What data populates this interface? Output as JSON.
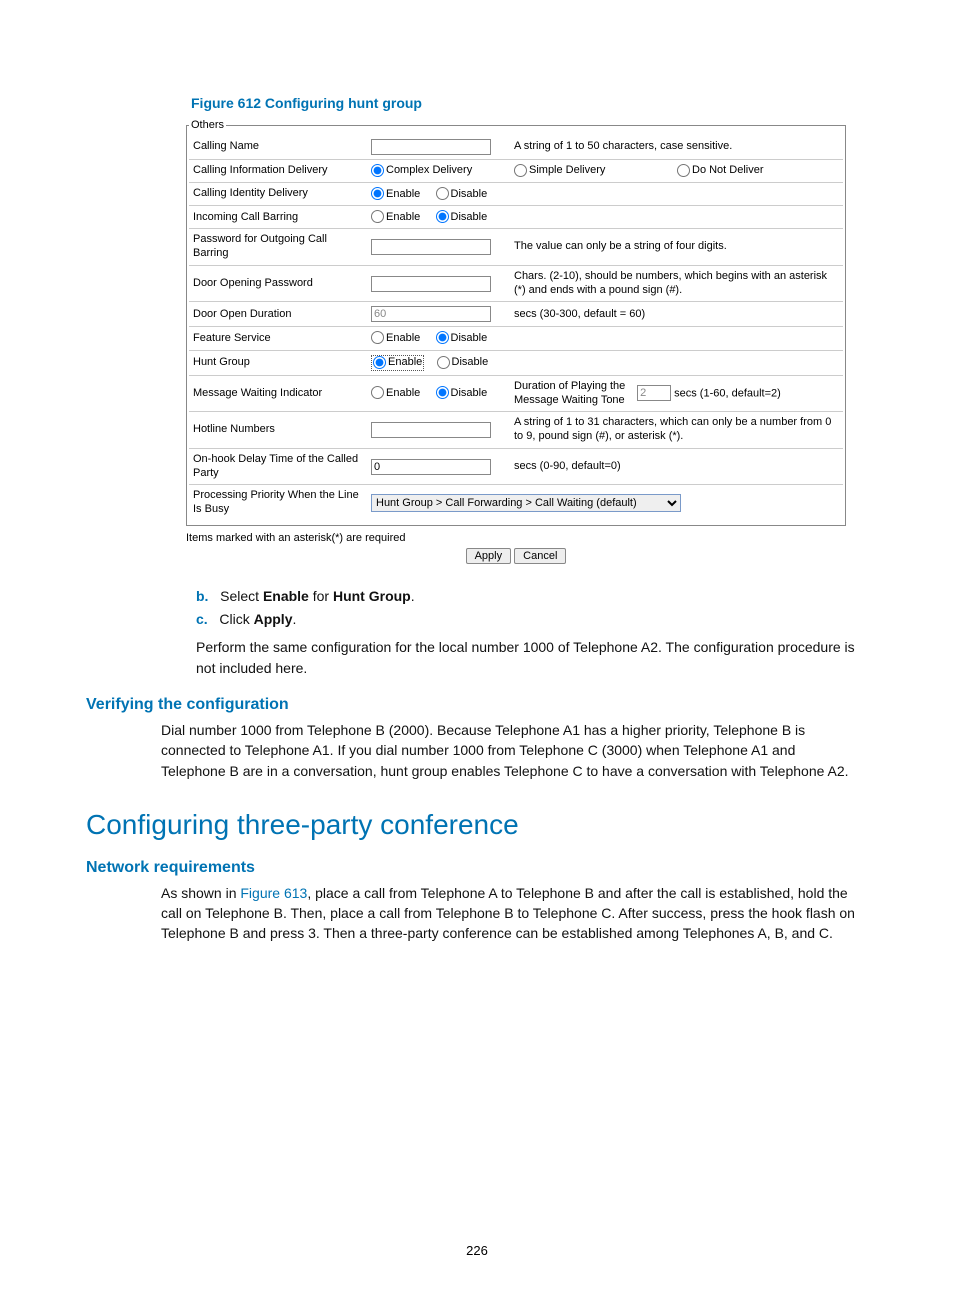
{
  "figure_caption": "Figure 612 Configuring hunt group",
  "fieldset_legend": "Others",
  "rows": {
    "calling_name": {
      "label": "Calling Name",
      "hint": "A string of 1 to 50 characters, case sensitive."
    },
    "cid": {
      "label": "Calling Information Delivery",
      "opt1": "Complex Delivery",
      "opt2": "Simple Delivery",
      "opt3": "Do Not Deliver"
    },
    "identity": {
      "label": "Calling Identity Delivery",
      "enable": "Enable",
      "disable": "Disable"
    },
    "barring": {
      "label": "Incoming Call Barring",
      "enable": "Enable",
      "disable": "Disable"
    },
    "pwd_out": {
      "label": "Password for Outgoing Call Barring",
      "hint": "The value can only be a string of four digits."
    },
    "door_pwd": {
      "label": "Door Opening Password",
      "hint": "Chars. (2-10), should be numbers, which begins with an asterisk (*) and ends with a pound sign (#)."
    },
    "door_dur": {
      "label": "Door Open Duration",
      "value": "60",
      "hint": "secs (30-300, default = 60)"
    },
    "feature": {
      "label": "Feature Service",
      "enable": "Enable",
      "disable": "Disable"
    },
    "hunt": {
      "label": "Hunt Group",
      "enable": "Enable",
      "disable": "Disable"
    },
    "mwi": {
      "label": "Message Waiting Indicator",
      "enable": "Enable",
      "disable": "Disable",
      "dur_label": "Duration of Playing the Message Waiting Tone",
      "dur_value": "2",
      "dur_hint": "secs (1-60, default=2)"
    },
    "hotline": {
      "label": "Hotline Numbers",
      "hint": "A string of 1 to 31 characters, which can only be a number from 0 to 9, pound sign (#), or asterisk (*)."
    },
    "onhook": {
      "label": "On-hook Delay Time of the Called Party",
      "value": "0",
      "hint": "secs (0-90, default=0)"
    },
    "priority": {
      "label": "Processing Priority When the Line Is Busy",
      "value": "Hunt Group > Call Forwarding > Call Waiting (default)"
    }
  },
  "required_note": "Items marked with an asterisk(*) are required",
  "apply_label": "Apply",
  "cancel_label": "Cancel",
  "steps": {
    "b": {
      "letter": "b.",
      "pre": "Select ",
      "bold1": "Enable",
      "mid": " for ",
      "bold2": "Hunt Group",
      "post": "."
    },
    "c": {
      "letter": "c.",
      "pre": "Click ",
      "bold1": "Apply",
      "post": "."
    }
  },
  "para_after_steps": "Perform the same configuration for the local number 1000 of Telephone A2. The configuration procedure is not included here.",
  "verify_heading": "Verifying the configuration",
  "verify_para": "Dial number 1000 from Telephone B (2000). Because Telephone A1 has a higher priority, Telephone B is connected to Telephone A1. If you dial number 1000 from Telephone C (3000) when Telephone A1 and Telephone B are in a conversation, hunt group enables Telephone C to have a conversation with Telephone A2.",
  "h2": "Configuring three-party conference",
  "netreq_heading": "Network requirements",
  "netreq_para_pre": "As shown in ",
  "netreq_link": "Figure 613",
  "netreq_para_post": ", place a call from Telephone A to Telephone B and after the call is established, hold the call on Telephone B. Then, place a call from Telephone B to Telephone C. After success, press the hook flash on Telephone B and press 3. Then a three-party conference can be established among Telephones A, B, and C.",
  "page_number": "226"
}
